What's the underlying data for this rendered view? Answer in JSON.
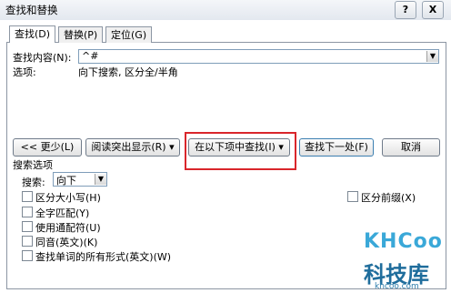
{
  "window": {
    "title": "查找和替换",
    "help_label": "?",
    "close_label": "X"
  },
  "tabs": [
    {
      "label": "查找(D)"
    },
    {
      "label": "替换(P)"
    },
    {
      "label": "定位(G)"
    }
  ],
  "find": {
    "label": "查找内容(N):",
    "value": "^#",
    "options_label": "选项:",
    "options_value": "向下搜索, 区分全/半角"
  },
  "buttons": {
    "less": "<< 更少(L)",
    "reading_highlight": "阅读突出显示(R) ▾",
    "find_in": "在以下项中查找(I) ▾",
    "find_next": "查找下一处(F)",
    "cancel": "取消"
  },
  "search_options": {
    "header": "搜索选项",
    "search_label": "搜索:",
    "search_value": "向下",
    "checkboxes": [
      {
        "label": "区分大小写(H)",
        "checked": false
      },
      {
        "label": "全字匹配(Y)",
        "checked": false
      },
      {
        "label": "使用通配符(U)",
        "checked": false
      },
      {
        "label": "同音(英文)(K)",
        "checked": false
      },
      {
        "label": "查找单词的所有形式(英文)(W)",
        "checked": false
      }
    ],
    "right_checkbox": {
      "label": "区分前缀(X)",
      "checked": false
    }
  },
  "watermark": {
    "brand": "KHCoo",
    "name": "科技库",
    "url": "khcoo.com"
  },
  "colors": {
    "highlight_box": "#d9262b",
    "watermark": "#3aa8d8"
  }
}
